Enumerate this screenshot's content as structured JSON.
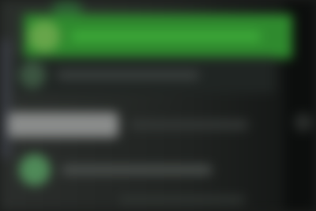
{
  "screen": {
    "state": "blurred",
    "colors": {
      "background": "#1b1d1b",
      "accent_green": "#2f8a2e",
      "avatar_green": "#67a54a",
      "highlight_gray": "#8a8c8b"
    }
  },
  "list": {
    "items": [
      {
        "selected": true,
        "icon": "avatar-icon"
      },
      {
        "selected": false,
        "icon": "avatar-icon"
      },
      {
        "selected": false,
        "icon": "input-pill-icon"
      },
      {
        "selected": false,
        "icon": "avatar-icon"
      }
    ]
  }
}
